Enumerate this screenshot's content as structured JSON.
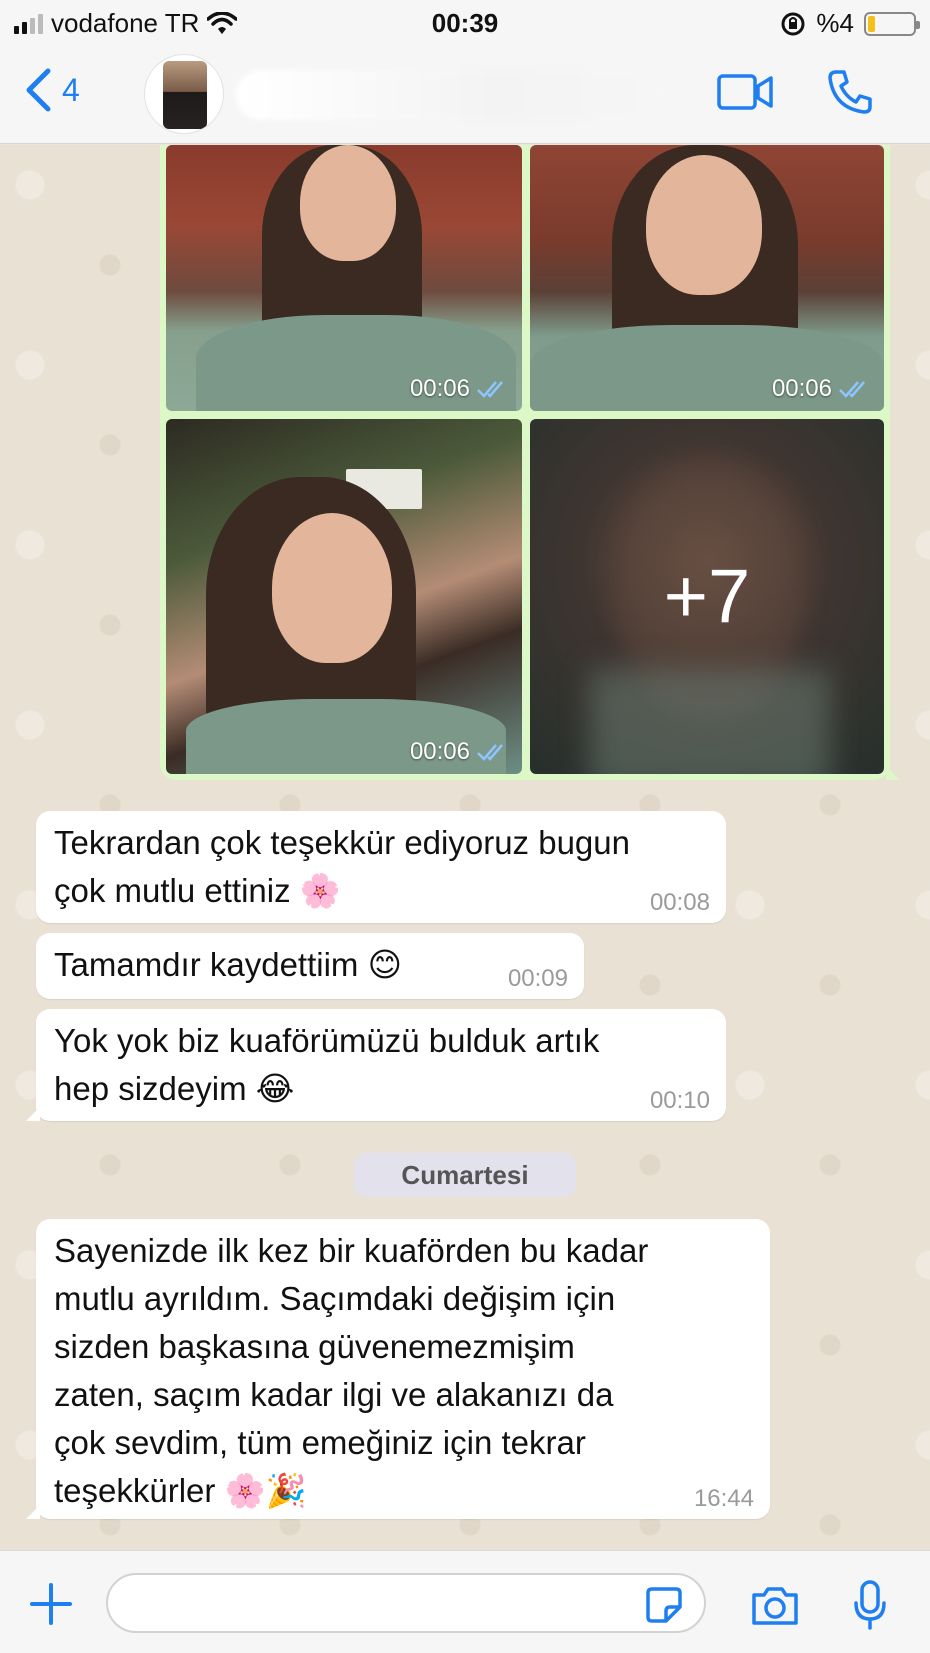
{
  "status_bar": {
    "carrier": "vodafone TR",
    "time": "00:39",
    "battery_text": "%4",
    "battery_level": 0.04
  },
  "header": {
    "back_count": "4"
  },
  "media_grid": {
    "tiles": [
      {
        "duration": "00:06"
      },
      {
        "duration": "00:06"
      },
      {
        "duration": "00:06"
      },
      {
        "more_label": "+7"
      }
    ]
  },
  "messages": [
    {
      "lines": [
        "Tekrardan çok teşekkür ediyoruz bugun",
        "çok mutlu ettiniz 🌸"
      ],
      "time": "00:08"
    },
    {
      "lines": [
        "Tamamdır kaydettiim 😊"
      ],
      "time": "00:09"
    },
    {
      "lines": [
        "Yok yok biz kuaförümüzü bulduk artık",
        "hep sizdeyim 😂"
      ],
      "time": "00:10"
    },
    {
      "lines": [
        "Sayenizde ilk kez bir kuaförden bu kadar",
        "mutlu ayrıldım. Saçımdaki değişim için",
        "sizden başkasına güvenemezmişim",
        "zaten, saçım kadar ilgi ve alakanızı da",
        "çok sevdim, tüm emeğiniz için tekrar",
        "teşekkürler 🌸🎉"
      ],
      "time": "16:44"
    }
  ],
  "day_separator": "Cumartesi",
  "colors": {
    "accent": "#1f7ff0",
    "outgoing_bubble": "#dcf8c6",
    "incoming_bubble": "#ffffff",
    "chat_background": "#e9e1d4"
  },
  "icons": {
    "back": "chevron-left-icon",
    "video": "video-camera-icon",
    "call": "phone-icon",
    "add": "plus-icon",
    "sticker": "sticker-icon",
    "camera": "camera-icon",
    "mic": "microphone-icon",
    "read": "double-check-icon"
  }
}
